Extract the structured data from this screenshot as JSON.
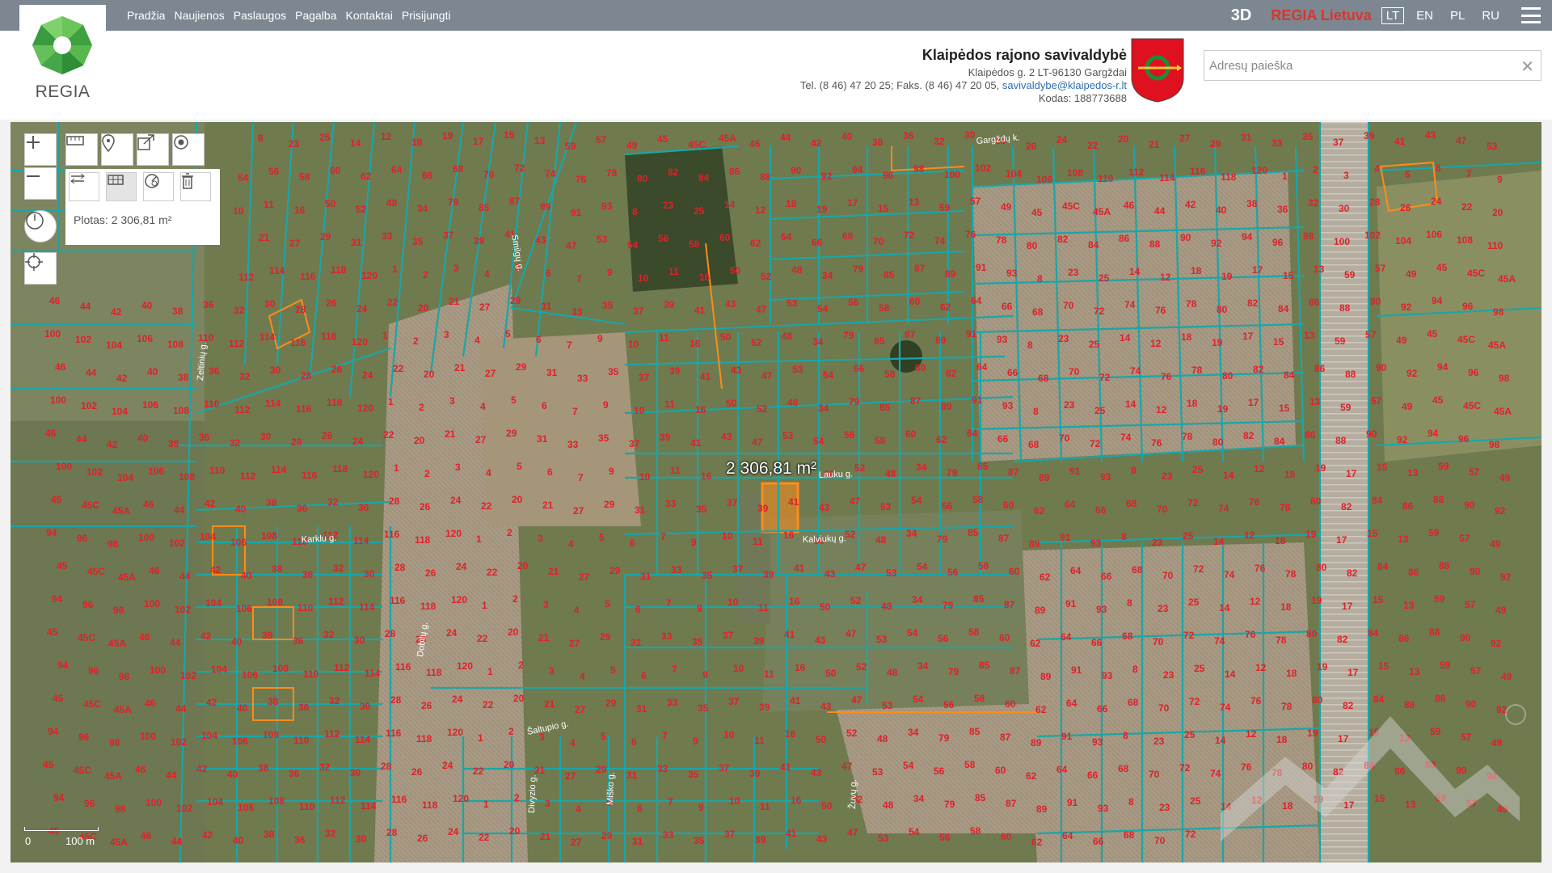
{
  "nav": {
    "items": [
      "Pradžia",
      "Naujienos",
      "Paslaugos",
      "Pagalba",
      "Kontaktai",
      "Prisijungti"
    ]
  },
  "logo": {
    "text": "REGIA"
  },
  "top_right": {
    "btn_3d": "3D",
    "regia_lt": "REGIA Lietuva",
    "languages": [
      "LT",
      "EN",
      "PL",
      "RU"
    ],
    "active_language": "LT"
  },
  "municipality": {
    "title": "Klaipėdos rajono savivaldybė",
    "address": "Klaipėdos g. 2 LT-96130 Gargždai",
    "phone_prefix": "Tel. (8 46) 47 20 25; Faks. (8 46) 47 20 05, ",
    "email": "savivaldybe@klaipedos-r.lt",
    "code": "Kodas: 188773688"
  },
  "search": {
    "placeholder": "Adresų paieška",
    "value": ""
  },
  "map": {
    "area_panel_text": "Plotas: 2 306,81 m²",
    "area_label": "2 306,81 m²",
    "scale": {
      "left": "0",
      "right": "100 m"
    },
    "streets": [
      "Karklu g.",
      "Kalviukų g.",
      "Lauku g.",
      "Šaltupio g.",
      "Smilgų g.",
      "Zeltinių g.",
      "Dobilų g.",
      "Divyzio g.",
      "Miško g.",
      "Žuvų g.",
      "Gargždų k."
    ],
    "parcel_numbers": [
      "8",
      "23",
      "25",
      "14",
      "12",
      "18",
      "19",
      "17",
      "15",
      "13",
      "59",
      "57",
      "49",
      "45",
      "45C",
      "45A",
      "46",
      "44",
      "42",
      "40",
      "38",
      "36",
      "32",
      "30",
      "28",
      "26",
      "24",
      "22",
      "20",
      "21",
      "27",
      "29",
      "31",
      "33",
      "35",
      "37",
      "39",
      "41",
      "43",
      "47",
      "53",
      "54",
      "56",
      "58",
      "60",
      "62",
      "64",
      "66",
      "68",
      "70",
      "72",
      "74",
      "76",
      "78",
      "80",
      "82",
      "84",
      "86",
      "88",
      "90",
      "92",
      "94",
      "96",
      "98",
      "100",
      "102",
      "104",
      "106",
      "108",
      "110",
      "112",
      "114",
      "116",
      "118",
      "120",
      "1",
      "2",
      "3",
      "4",
      "5",
      "6",
      "7",
      "9",
      "10",
      "11",
      "16",
      "50",
      "52",
      "48",
      "34",
      "79",
      "85",
      "87",
      "89",
      "91",
      "93"
    ],
    "colors": {
      "parcel": "#1aa6a6",
      "highlight": "#ff8c1a",
      "label": "#e0202a"
    }
  }
}
